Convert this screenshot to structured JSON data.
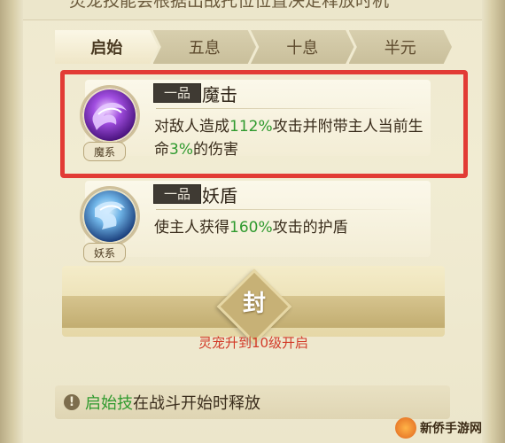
{
  "header": {
    "partial_text": "灵宠技能会根据出战托位位置决定释放时机"
  },
  "tabs": [
    {
      "label": "启始",
      "active": true
    },
    {
      "label": "五息",
      "active": false
    },
    {
      "label": "十息",
      "active": false
    },
    {
      "label": "半元",
      "active": false
    }
  ],
  "skills": [
    {
      "grade": "一品",
      "name": "魔击",
      "type_tag": "魔系",
      "icon": "demon-strike-icon",
      "desc_parts": [
        "对敌人造成",
        "112%",
        "攻击并附带主人当前生命",
        "3%",
        "的伤害"
      ]
    },
    {
      "grade": "一品",
      "name": "妖盾",
      "type_tag": "妖系",
      "icon": "demon-shield-icon",
      "desc_parts": [
        "使主人获得",
        "160%",
        "攻击的护盾"
      ]
    }
  ],
  "locked_slot": {
    "seal_char": "封",
    "unlock_text": "灵宠升到10级开启"
  },
  "footer": {
    "info_icon": "!",
    "key": "启始技",
    "text": "在战斗开始时释放"
  },
  "watermark": {
    "text": "新侨手游网"
  },
  "colors": {
    "highlight_red": "#e23b35",
    "value_green": "#2f9a2e",
    "lock_red": "#d23a28"
  }
}
